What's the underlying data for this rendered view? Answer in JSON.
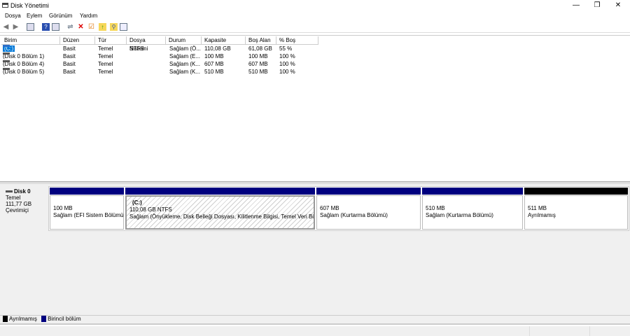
{
  "window": {
    "title": "Disk Yönetimi",
    "minimize": "—",
    "restore": "❐",
    "close": "✕"
  },
  "menu": [
    "Dosya",
    "Eylem",
    "Görünüm",
    "Yardım"
  ],
  "toolbar": [
    "back",
    "forward",
    "console",
    "help",
    "properties",
    "connect",
    "delete",
    "check",
    "up",
    "find",
    "list"
  ],
  "table": {
    "columns": [
      "Birim",
      "Düzen",
      "Tür",
      "Dosya Sistemi",
      "Durum",
      "Kapasite",
      "Boş Alan",
      "% Boş"
    ],
    "rows": [
      [
        "(C:)",
        "Basit",
        "Temel",
        "NTFS",
        "Sağlam (Ö...",
        "110,08 GB",
        "61,08 GB",
        "55 %"
      ],
      [
        "(Disk 0 Bölüm 1)",
        "Basit",
        "Temel",
        "",
        "Sağlam (E...",
        "100 MB",
        "100 MB",
        "100 %"
      ],
      [
        "(Disk 0 Bölüm 4)",
        "Basit",
        "Temel",
        "",
        "Sağlam (K...",
        "607 MB",
        "607 MB",
        "100 %"
      ],
      [
        "(Disk 0 Bölüm 5)",
        "Basit",
        "Temel",
        "",
        "Sağlam (K...",
        "510 MB",
        "510 MB",
        "100 %"
      ]
    ]
  },
  "disk": {
    "name": "Disk 0",
    "type": "Temel",
    "size": "111,77 GB",
    "status": "Çevrimiçi",
    "partitions": [
      {
        "label": "",
        "size": "100 MB",
        "desc": "Sağlam (EFI Sistem Bölümü)",
        "color": "#00007f"
      },
      {
        "label": "(C:)",
        "size": "110,08 GB NTFS",
        "desc": "Sağlam (Önyükleme, Disk Belleği Dosyası, Kilitlenme Bilgisi, Temel Veri Bölümü)",
        "color": "#00007f"
      },
      {
        "label": "",
        "size": "607 MB",
        "desc": "Sağlam (Kurtarma Bölümü)",
        "color": "#00007f"
      },
      {
        "label": "",
        "size": "510 MB",
        "desc": "Sağlam (Kurtarma Bölümü)",
        "color": "#00007f"
      },
      {
        "label": "",
        "size": "511 MB",
        "desc": "Ayrılmamış",
        "color": "#000000"
      }
    ]
  },
  "legend": [
    {
      "label": "Ayrılmamış",
      "color": "#000000"
    },
    {
      "label": "Birincil bölüm",
      "color": "#00007f"
    }
  ]
}
